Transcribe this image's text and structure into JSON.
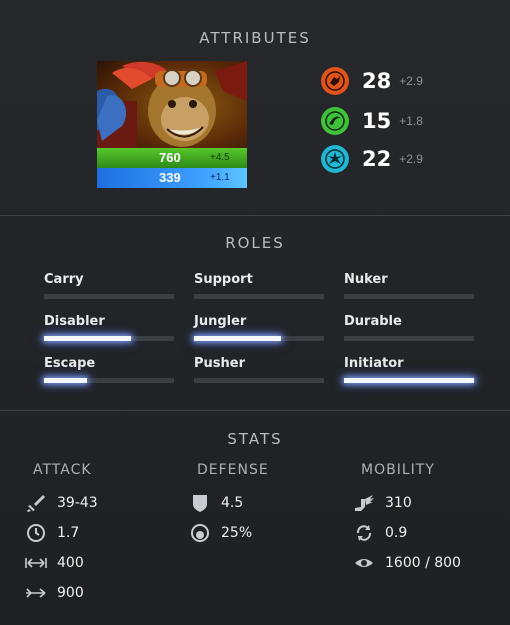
{
  "attributes": {
    "title": "ATTRIBUTES",
    "health": {
      "value": "760",
      "regen": "+4.5"
    },
    "mana": {
      "value": "339",
      "regen": "+1.1"
    },
    "stats": [
      {
        "name": "strength",
        "value": "28",
        "gain": "+2.9",
        "color": "#e0531b",
        "icon": "strength-fist-icon"
      },
      {
        "name": "agility",
        "value": "15",
        "gain": "+1.8",
        "color": "#3fc23a",
        "icon": "agility-swirl-icon"
      },
      {
        "name": "intelligence",
        "value": "22",
        "gain": "+2.9",
        "color": "#21b6d1",
        "icon": "intelligence-burst-icon"
      }
    ]
  },
  "roles": {
    "title": "ROLES",
    "items": [
      {
        "label": "Carry",
        "level": 0
      },
      {
        "label": "Support",
        "level": 0
      },
      {
        "label": "Nuker",
        "level": 0
      },
      {
        "label": "Disabler",
        "level": 0.67
      },
      {
        "label": "Jungler",
        "level": 0.67
      },
      {
        "label": "Durable",
        "level": 0
      },
      {
        "label": "Escape",
        "level": 0.33
      },
      {
        "label": "Pusher",
        "level": 0
      },
      {
        "label": "Initiator",
        "level": 1.0
      }
    ]
  },
  "stats": {
    "title": "STATS",
    "attack": {
      "heading": "ATTACK",
      "damage": "39-43",
      "attack_time": "1.7",
      "attack_range": "400",
      "projectile_speed": "900"
    },
    "defense": {
      "heading": "DEFENSE",
      "armor": "4.5",
      "magic_resistance": "25%"
    },
    "mobility": {
      "heading": "MOBILITY",
      "move_speed": "310",
      "turn_rate": "0.9",
      "vision": "1600 / 800"
    }
  }
}
